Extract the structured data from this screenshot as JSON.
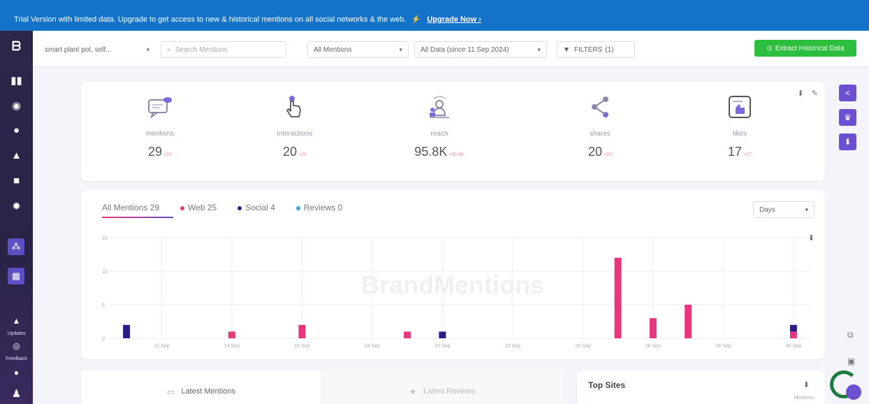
{
  "banner": {
    "text": "Trial Version with limited data. Upgrade to get access to new & historical mentions on all social networks & the web.",
    "upgrade_label": "Upgrade Now ›"
  },
  "toolbar": {
    "project_label": "smart plant pot, self...",
    "search_placeholder": "Search Mentions",
    "mentions_filter": "All Mentions",
    "date_filter": "All Data (since 11 Sep 2024)",
    "filters_label": "FILTERS",
    "filters_count": "(1)",
    "extract_label": "Extract Historical Data"
  },
  "sidebar": {
    "updates_label": "Updates",
    "feedback_label": "Feedback"
  },
  "stats": [
    {
      "icon": "mentions-icon",
      "label": "mentions",
      "value": "29",
      "sub": "+29"
    },
    {
      "icon": "interactions-icon",
      "label": "interactions",
      "value": "20",
      "sub": "+20"
    },
    {
      "icon": "reach-icon",
      "label": "reach",
      "value": "95.8K",
      "sub": "+95.8K"
    },
    {
      "icon": "shares-icon",
      "label": "shares",
      "value": "20",
      "sub": "+20"
    },
    {
      "icon": "likes-icon",
      "label": "likes",
      "value": "17",
      "sub": "+17"
    }
  ],
  "tabs": [
    {
      "label": "All Mentions 29",
      "color": ""
    },
    {
      "label": "Web 25",
      "color": "#e8367c"
    },
    {
      "label": "Social 4",
      "color": "#2b1d87"
    },
    {
      "label": "Reviews 0",
      "color": "#3aa3e3"
    }
  ],
  "days_select": "Days",
  "watermark": "BrandMentions",
  "chart_data": {
    "type": "bar",
    "x": [
      "11 Sep",
      "12 Sep",
      "13 Sep",
      "14 Sep",
      "15 Sep",
      "16 Sep",
      "17 Sep",
      "18 Sep",
      "19 Sep",
      "20 Sep",
      "21 Sep",
      "22 Sep",
      "23 Sep",
      "24 Sep",
      "25 Sep",
      "26 Sep",
      "27 Sep",
      "28 Sep",
      "29 Sep",
      "30 Sep"
    ],
    "tick_labels": [
      "12 Sep",
      "14 Sep",
      "16 Sep",
      "18 Sep",
      "20 Sep",
      "22 Sep",
      "24 Sep",
      "26 Sep",
      "28 Sep",
      "30 Sep"
    ],
    "series": [
      {
        "name": "Web",
        "color": "#e8367c",
        "values": [
          0,
          0,
          0,
          1,
          0,
          2,
          0,
          0,
          1,
          0,
          0,
          0,
          0,
          0,
          12,
          3,
          5,
          0,
          0,
          1
        ]
      },
      {
        "name": "Social",
        "color": "#2b1d87",
        "values": [
          2,
          0,
          0,
          0,
          0,
          0,
          0,
          0,
          0,
          1,
          0,
          0,
          0,
          0,
          0,
          0,
          0,
          0,
          0,
          1
        ]
      }
    ],
    "y_ticks": [
      0,
      5,
      10,
      15
    ],
    "ylim": [
      0,
      15
    ],
    "stacked": true,
    "grid": true
  },
  "bottom": {
    "latest_mentions": "Latest Mentions",
    "latest_reviews": "Latest Reviews",
    "top_sites": "Top Sites",
    "top_sites_sub": "Mentions"
  }
}
